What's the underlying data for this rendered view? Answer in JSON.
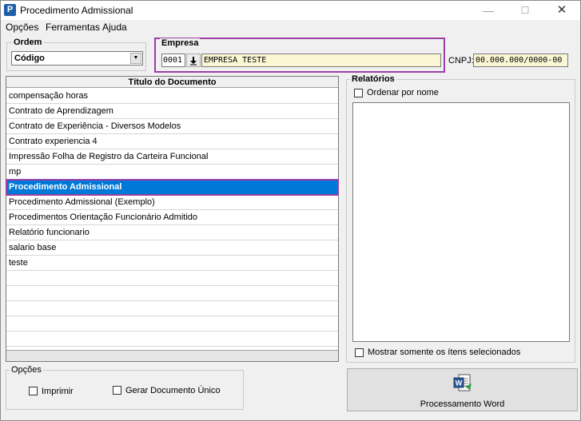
{
  "window": {
    "title": "Procedimento Admissional",
    "app_icon_letter": "P",
    "minimize_glyph": "—",
    "maximize_glyph": "☐",
    "close_glyph": "✕"
  },
  "menu": [
    "Opções",
    "Ferramentas",
    "Ajuda"
  ],
  "ordem": {
    "label": "Ordem",
    "selected": "Código"
  },
  "empresa": {
    "label": "Empresa",
    "code": "0001",
    "name": "EMPRESA TESTE",
    "cnpj_label": "CNPJ:",
    "cnpj": "00.000.000/0000-00"
  },
  "documents": {
    "header": "Título do Documento",
    "items": [
      "compensação horas",
      "Contrato de Aprendizagem",
      "Contrato de Experiência - Diversos Modelos",
      "Contrato experiencia 4",
      "Impressão Folha de Registro da Carteira Funcional",
      "mp",
      "Procedimento Admissional",
      "Procedimento Admissional (Exemplo)",
      "Procedimentos Orientação Funcionário Admitido",
      "Relatório funcionario",
      "salario base",
      "teste"
    ],
    "selected_index": 6
  },
  "relatorios": {
    "label": "Relatórios",
    "sort_by_name": "Ordenar por nome",
    "show_selected_only": "Mostrar somente os ítens selecionados"
  },
  "opcoes": {
    "label": "Opções",
    "imprimir": "Imprimir",
    "gerar_unico": "Gerar Documento Único"
  },
  "word_button": {
    "label": "Processamento Word",
    "icon": "word-document-icon"
  },
  "colors": {
    "selection": "#0078d7",
    "highlight_border": "#9b3fa5",
    "readonly_field": "#fbf7d4"
  }
}
